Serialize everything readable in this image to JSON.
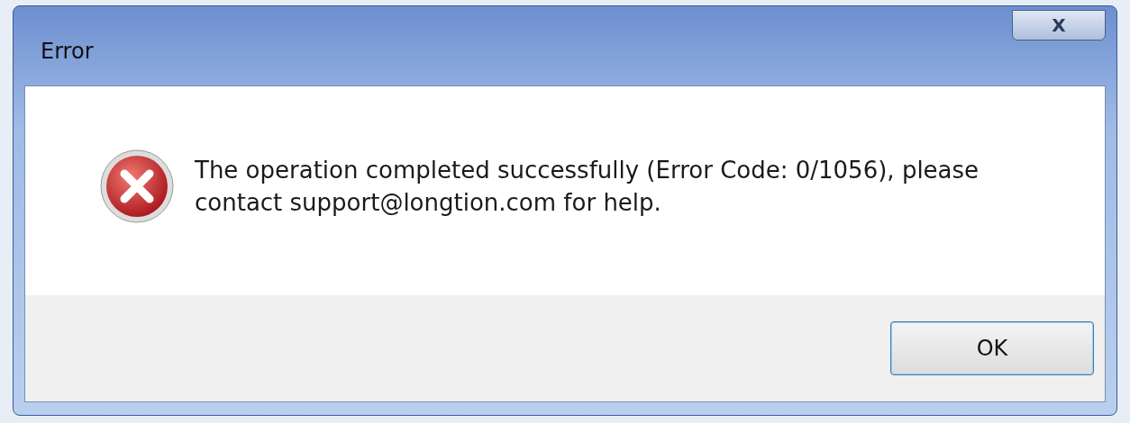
{
  "window": {
    "title": "Error",
    "close": "X"
  },
  "message": "The operation completed successfully (Error Code: 0/1056), please contact support@longtion.com for help.",
  "buttons": [
    {
      "label": "OK",
      "selected": true
    }
  ]
}
